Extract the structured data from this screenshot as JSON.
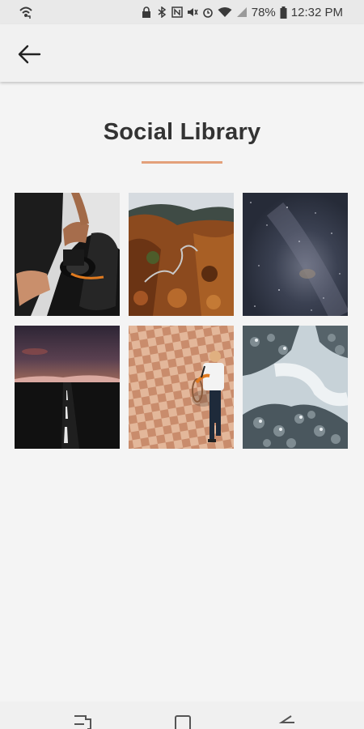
{
  "status_bar": {
    "battery_percent": "78%",
    "time": "12:32 PM",
    "icons": [
      "wifi-call-icon",
      "lock-icon",
      "bluetooth-icon",
      "nfc-icon",
      "mute-icon",
      "alarm-icon",
      "wifi-icon",
      "signal-icon",
      "battery-icon"
    ]
  },
  "app_bar": {
    "back_icon": "arrow-left-icon"
  },
  "page": {
    "title": "Social Library",
    "accent_color": "#e3a07a"
  },
  "gallery": {
    "photos": [
      {
        "subject": "camera-in-backpack"
      },
      {
        "subject": "autumn-forest-road"
      },
      {
        "subject": "night-sky-milky-way"
      },
      {
        "subject": "dusk-road"
      },
      {
        "subject": "cyclist-on-tiles"
      },
      {
        "subject": "snowy-forest-aerial"
      }
    ]
  },
  "nav_bar": {
    "icons": [
      "recent-apps-icon",
      "home-icon",
      "back-icon"
    ]
  }
}
